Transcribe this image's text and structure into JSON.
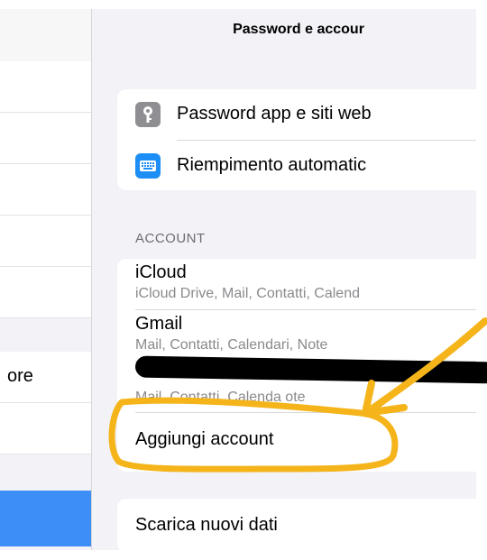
{
  "sidebar": {
    "partial_label": "ore"
  },
  "header": {
    "title": "Password e accour"
  },
  "passwords_group": {
    "items": [
      {
        "label": "Password app e siti web",
        "icon": "key-icon"
      },
      {
        "label": "Riempimento automatic",
        "icon": "keyboard-icon"
      }
    ]
  },
  "accounts": {
    "section_title": "ACCOUNT",
    "items": [
      {
        "name": "iCloud",
        "detail": "iCloud Drive, Mail, Contatti, Calend"
      },
      {
        "name": "Gmail",
        "detail": "Mail, Contatti, Calendari, Note"
      },
      {
        "name": "",
        "detail": "Mail, Contatti, Calenda    ote"
      }
    ],
    "add_account": "Aggiungi account"
  },
  "fetch": {
    "label": "Scarica nuovi dati"
  },
  "colors": {
    "annotation": "#f4b41a",
    "selection": "#3d8ef7",
    "keyboard_icon": "#1c8ef5"
  }
}
